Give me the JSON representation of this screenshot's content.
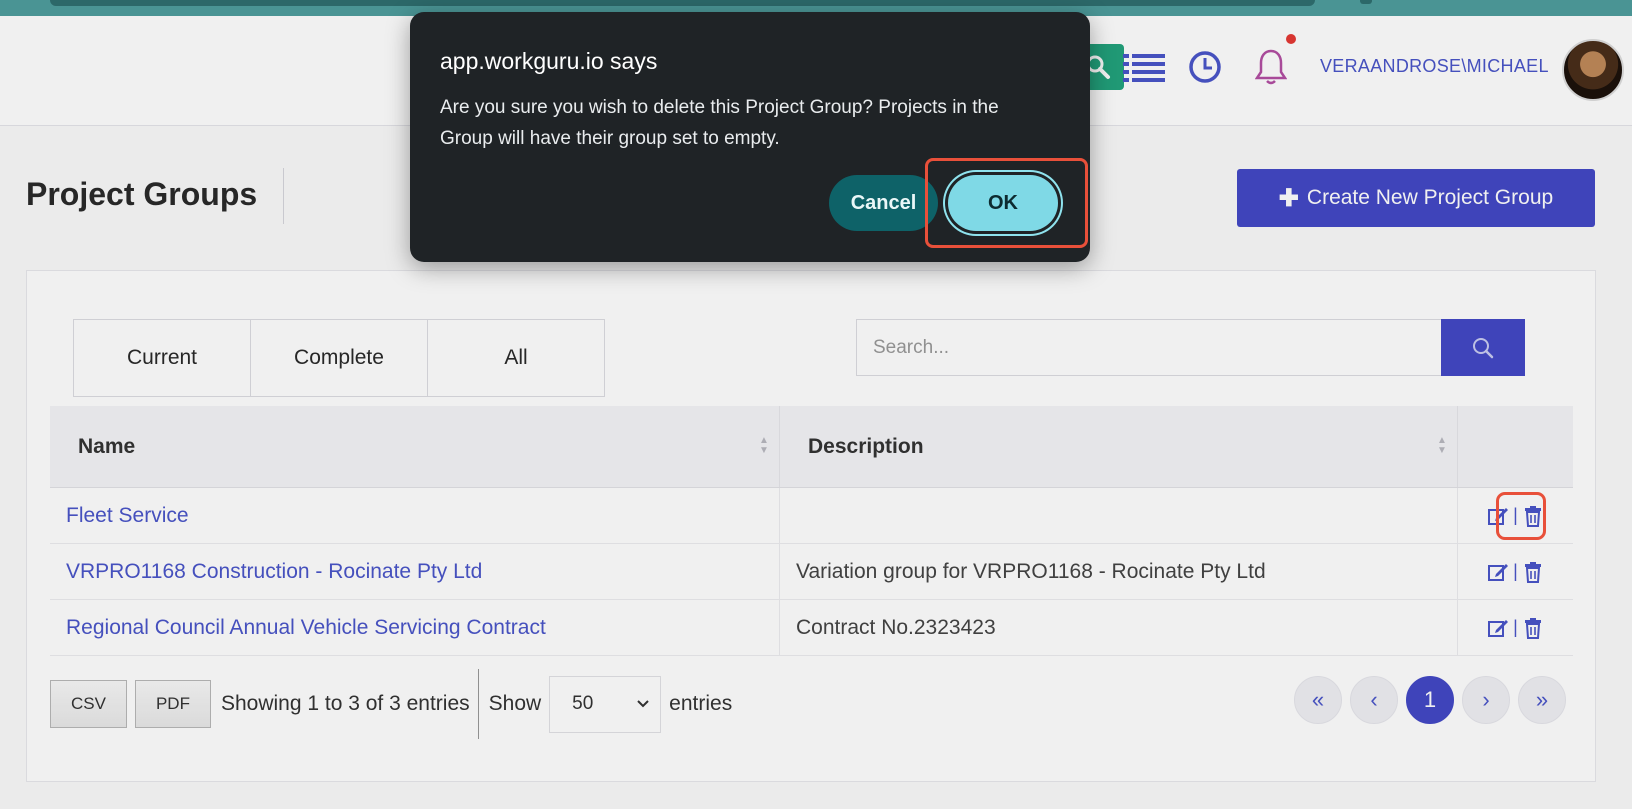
{
  "header": {
    "user_label": "VERAANDROSE\\MICHAEL",
    "icons": [
      "search-icon",
      "list-icon",
      "clock-icon",
      "bell-icon"
    ],
    "accent_color": "#4349c6",
    "search_color": "#22a37d"
  },
  "page": {
    "title": "Project Groups",
    "create_button_label": "Create New Project Group"
  },
  "filters": {
    "tabs": [
      {
        "label": "Current"
      },
      {
        "label": "Complete"
      },
      {
        "label": "All"
      }
    ]
  },
  "search": {
    "placeholder": "Search..."
  },
  "table": {
    "columns": {
      "name": "Name",
      "description": "Description"
    },
    "rows": [
      {
        "name": "Fleet Service",
        "description": ""
      },
      {
        "name": "VRPRO1168 Construction - Rocinate Pty Ltd",
        "description": "Variation group for VRPRO1168 - Rocinate Pty Ltd"
      },
      {
        "name": "Regional Council Annual Vehicle Servicing Contract",
        "description": "Contract No.2323423"
      }
    ]
  },
  "footer": {
    "csv_label": "CSV",
    "pdf_label": "PDF",
    "showing_text": "Showing 1 to 3 of 3 entries",
    "show_label": "Show",
    "entries_value": "50",
    "entries_label": "entries"
  },
  "pagination": {
    "first": "«",
    "prev": "‹",
    "current": "1",
    "next": "›",
    "last": "»"
  },
  "dialog": {
    "title": "app.workguru.io says",
    "message": "Are you sure you wish to delete this Project Group? Projects in the Group will have their group set to empty.",
    "cancel_label": "Cancel",
    "ok_label": "OK"
  },
  "highlight_color": "#e8503a"
}
